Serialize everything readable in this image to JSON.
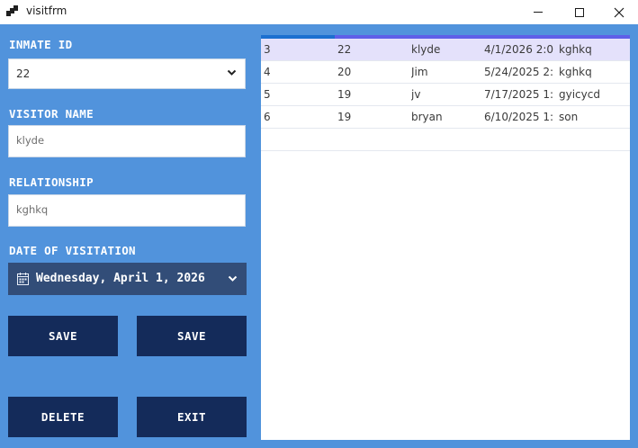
{
  "window": {
    "title": "visitfrm"
  },
  "form": {
    "inmate_label": "INMATE ID",
    "inmate_value": "22",
    "visitor_label": "VISITOR NAME",
    "visitor_value": "klyde",
    "relationship_label": "RELATIONSHIP",
    "relationship_value": "kghkq",
    "date_label": "DATE OF VISITATION",
    "date_value": "Wednesday, April 1, 2026"
  },
  "buttons": {
    "save1": "SAVE",
    "save2": "SAVE",
    "delete": "DELETE",
    "exit": "EXIT"
  },
  "grid": {
    "rows": [
      [
        "3",
        "22",
        "klyde",
        "4/1/2026 2:0...",
        "kghkq"
      ],
      [
        "4",
        "20",
        "Jim",
        "5/24/2025 2:...",
        "kghkq"
      ],
      [
        "5",
        "19",
        "jv",
        "7/17/2025 1:...",
        "gyicycd"
      ],
      [
        "6",
        "19",
        "bryan",
        "6/10/2025 1:...",
        "son"
      ]
    ],
    "selected_row": 0
  },
  "colors": {
    "background": "#5193dc",
    "button": "#142b5a",
    "datepicker": "#324d78",
    "selected_row": "#e4e1fb"
  }
}
